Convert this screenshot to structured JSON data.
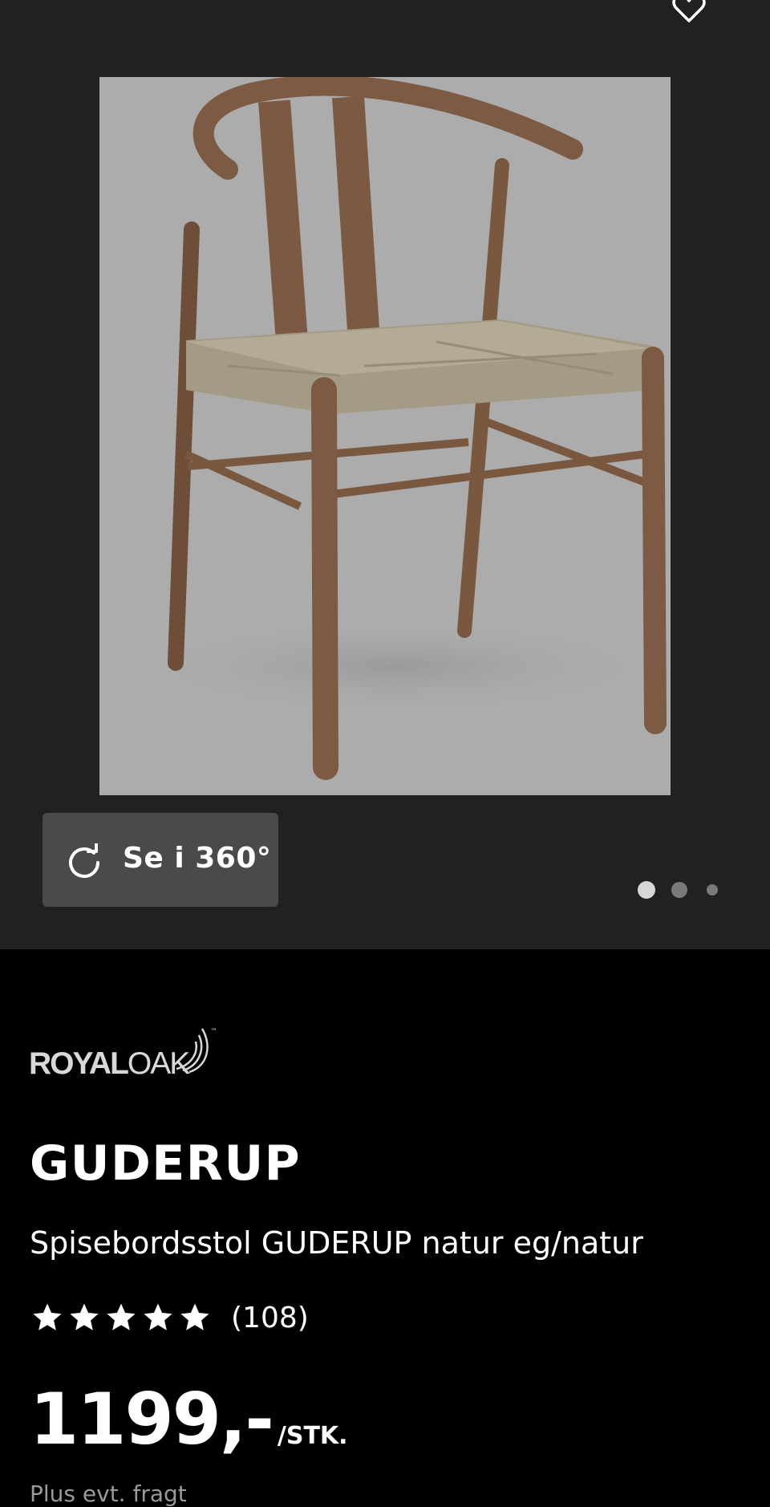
{
  "product": {
    "brand_logo_text": "ROYALOAK",
    "brand_logo_bold": "ROYAL",
    "brand_logo_light": "OAK",
    "brand_logo_tm": "™",
    "name": "GUDERUP",
    "description": "Spisebordsstol GUDERUP natur eg/natur",
    "rating_stars": 5,
    "rating_count": "(108)",
    "price": "1199,-",
    "price_unit": "/STK.",
    "shipping_note": "Plus evt. fragt"
  },
  "gallery": {
    "view_360_label": "Se i 360°",
    "slide_count": 3,
    "active_slide": 1,
    "image_background": "#acacac"
  },
  "icons": {
    "favorite": "heart-outline-icon",
    "rotate": "rotate-icon",
    "star": "star-icon"
  },
  "colors": {
    "gallery_bg": "#212121",
    "page_bg": "#000000",
    "button_bg": "#4a4a4a",
    "text": "#ffffff",
    "muted_text": "#9a9a9a"
  }
}
